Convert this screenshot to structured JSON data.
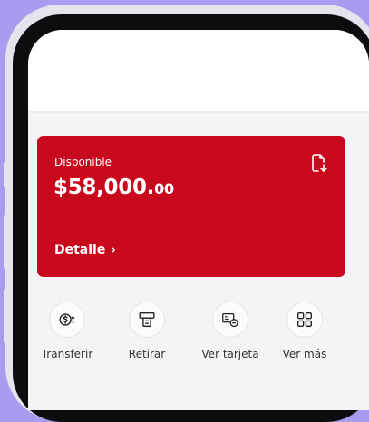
{
  "colors": {
    "background": "#a99cf0",
    "card": "#c8081d",
    "accent": "#c8081d",
    "text": "#333333"
  },
  "card": {
    "label": "Disponible",
    "balance_main": "$58,000.",
    "balance_cents": "00",
    "detail_label": "Detalle",
    "detail_icon": "chevron-right-icon",
    "action_icon": "download-document-icon"
  },
  "actions": [
    {
      "label": "Transferir",
      "icon": "transfer-money-icon"
    },
    {
      "label": "Retirar",
      "icon": "atm-withdraw-icon"
    },
    {
      "label": "Ver tarjeta",
      "icon": "card-view-icon"
    },
    {
      "label": "Ver más",
      "icon": "grid-more-icon"
    }
  ]
}
